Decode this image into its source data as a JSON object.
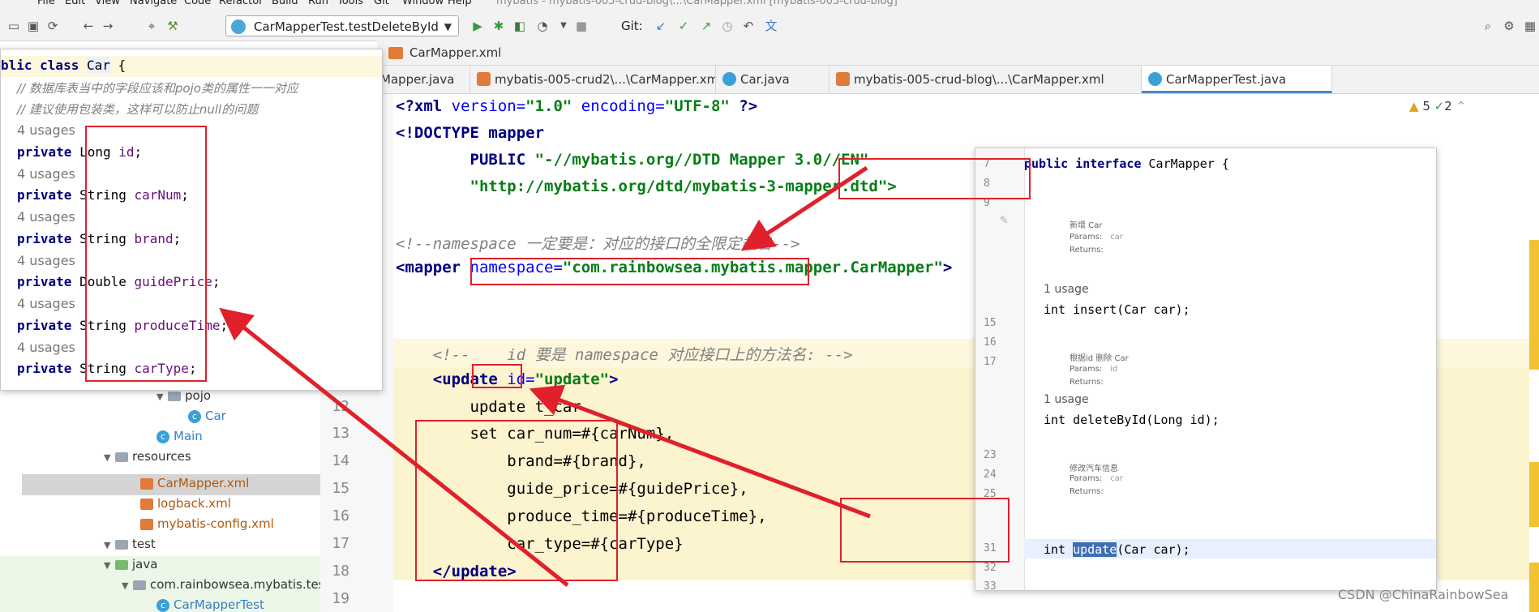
{
  "menu": [
    "File",
    "Edit",
    "View",
    "Navigate",
    "Code",
    "Refactor",
    "Build",
    "Run",
    "Tools",
    "Git",
    "Window",
    "Help"
  ],
  "window_title": "mybatis - mybatis-005-crud-blog\\...\\CarMapper.xml [mybatis-005-crud-blog]",
  "toolbar": {
    "run_config": "CarMapperTest.testDeleteById",
    "git_label": "Git:"
  },
  "nav_file": "CarMapper.xml",
  "tabs": [
    {
      "label": "Mapper.java",
      "active": false
    },
    {
      "label": "mybatis-005-crud2\\...\\CarMapper.xml",
      "active": false
    },
    {
      "label": "Car.java",
      "active": false
    },
    {
      "label": "mybatis-005-crud-blog\\...\\CarMapper.xml",
      "active": false
    },
    {
      "label": "CarMapperTest.java",
      "active": true
    }
  ],
  "inspections": {
    "warnings": "5",
    "checks": "2"
  },
  "editor": {
    "line_numbers": [
      "12",
      "13",
      "14",
      "15",
      "16",
      "17",
      "18",
      "19"
    ],
    "lines": {
      "l1a": "<?xml",
      "l1b": " version=",
      "l1c": "\"1.0\"",
      "l1d": " encoding=",
      "l1e": "\"UTF-8\"",
      "l1f": " ?>",
      "l2": "<!DOCTYPE mapper",
      "l3a": "        PUBLIC ",
      "l3b": "\"-//mybatis.org//DTD Mapper 3.0//EN\"",
      "l4": "        \"http://mybatis.org/dtd/mybatis-3-mapper.dtd\">",
      "l6": "<!--namespace 一定要是：对应的接口的全限定类名-->",
      "l7a": "<mapper",
      "l7b": " namespace=",
      "l7c": "\"com.rainbowsea.mybatis.mapper.CarMapper\"",
      "l7d": ">",
      "l10": "    <!--    id 要是 namespace 对应接口上的方法名: -->",
      "l11a": "    <update",
      "l11b": " id=",
      "l11c": "\"update\"",
      "l11d": ">",
      "l12": "        update t_car",
      "l13": "        set car_num=#{carNum},",
      "l14": "            brand=#{brand},",
      "l15": "            guide_price=#{guidePrice},",
      "l16": "            produce_time=#{produceTime},",
      "l17": "            car_type=#{carType}",
      "l18": "    </update>"
    }
  },
  "project_tree": {
    "pojo": "pojo",
    "car": "Car",
    "main": "Main",
    "resources": "resources",
    "carmapper": "CarMapper.xml",
    "logback": "logback.xml",
    "config": "mybatis-config.xml",
    "test": "test",
    "java": "java",
    "pkg": "com.rainbowsea.mybatis.tes",
    "cmt": "CarMapperTest"
  },
  "class_popup": {
    "header_a": "blic class ",
    "header_b": "Car",
    "header_c": " {",
    "comment1": "// 数据库表当中的字段应该和pojo类的属性一一对应",
    "comment2": "// 建议使用包装类，这样可以防止null的问题",
    "usages": "4 usages",
    "fields": [
      {
        "mod": "private ",
        "type": "Long ",
        "name": "id"
      },
      {
        "mod": "private ",
        "type": "String ",
        "name": "carNum"
      },
      {
        "mod": "private ",
        "type": "String ",
        "name": "brand"
      },
      {
        "mod": "private ",
        "type": "Double ",
        "name": "guidePrice"
      },
      {
        "mod": "private ",
        "type": "String ",
        "name": "produceTime"
      },
      {
        "mod": "private ",
        "type": "String ",
        "name": "carType"
      }
    ]
  },
  "interface_popup": {
    "line_numbers": [
      "7",
      "8",
      "9",
      "15",
      "16",
      "17",
      "23",
      "24",
      "25",
      "31",
      "32",
      "33"
    ],
    "header_a": "public interface ",
    "header_b": "CarMapper",
    "header_c": " {",
    "doc1": "新增 Car",
    "doc2": "根据id 删除 Car",
    "doc3": "修改汽车信息",
    "params": "Params:",
    "returns": "Returns:",
    "p_car": "car",
    "p_id": "id",
    "usage": "1 usage",
    "m1": "int insert(Car car);",
    "m2": "int deleteById(Long id);",
    "m3a": "int ",
    "m3b": "update",
    "m3c": "(Car car);"
  },
  "watermark": "CSDN @ChinaRainbowSea",
  "colors": {
    "arrow": "#e0202a",
    "highlight": "#fdf7dd",
    "accent": "#4a88c7"
  }
}
